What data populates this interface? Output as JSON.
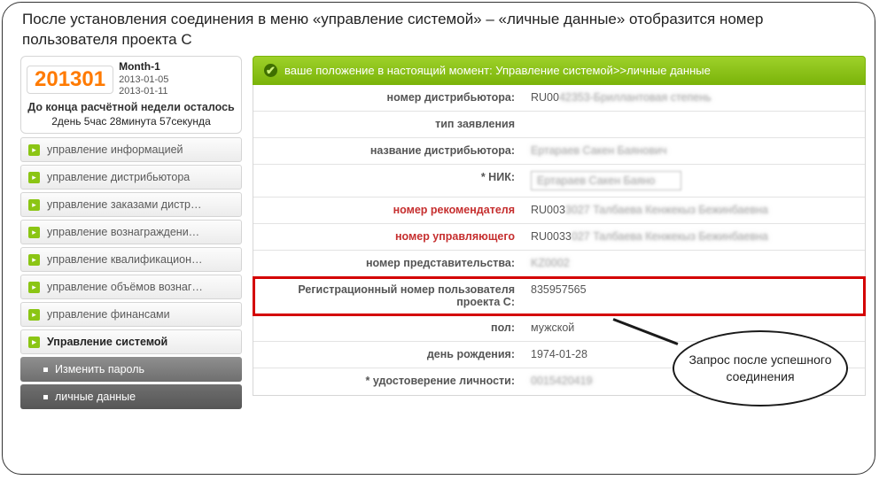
{
  "title": "После установления соединения  в меню «управление системой» – «личные данные» отобразится номер пользователя проекта С",
  "period": {
    "code": "201301",
    "month_label": "Month-1",
    "date_from": "2013-01-05",
    "date_to": "2013-01-11",
    "countdown_label": "До конца расчётной недели осталось",
    "countdown_time": "2день 5час 28минута 57секунда"
  },
  "menu": {
    "items": [
      "управление информацией",
      "управление дистрибьютора",
      "управление заказами дистр…",
      "управление вознаграждени…",
      "управление квалификацион…",
      "управление объёмов вознаг…",
      "управление финансами",
      "Управление системой"
    ],
    "sub": {
      "change_password": "Изменить пароль",
      "personal_data": "личные данные"
    }
  },
  "breadcrumb": "ваше положение в настоящий момент: Управление системой>>личные данные",
  "form": {
    "distr_number_label": "номер дистрибьютора:",
    "distr_number_value": "RU0042353-Бриллантовая степень",
    "app_type_label": "тип заявления",
    "distr_name_label": "название дистрибьютора:",
    "distr_name_value": "Ертараев Сакен Баянович",
    "nick_label": "* НИК:",
    "nick_value": "Ертараев Сакен Баяно",
    "recommender_label": "номер рекомендателя",
    "recommender_value": "RU0033027  Талбаева Кенжекыз Бежинбаевна",
    "manager_label": "номер управляющего",
    "manager_value": "RU0033027  Талбаева Кенжекыз Бежинбаевна",
    "rep_label": "номер представительства:",
    "rep_value": "KZ0002",
    "project_c_label": "Регистрационный номер пользователя проекта С:",
    "project_c_value": "835957565",
    "gender_label": "пол:",
    "gender_value": "мужской",
    "dob_label": "день рождения:",
    "dob_value": "1974-01-28",
    "id_label": "* удостоверение личности:",
    "id_value": "0015420419"
  },
  "callout": "Запрос после успешного соединения"
}
